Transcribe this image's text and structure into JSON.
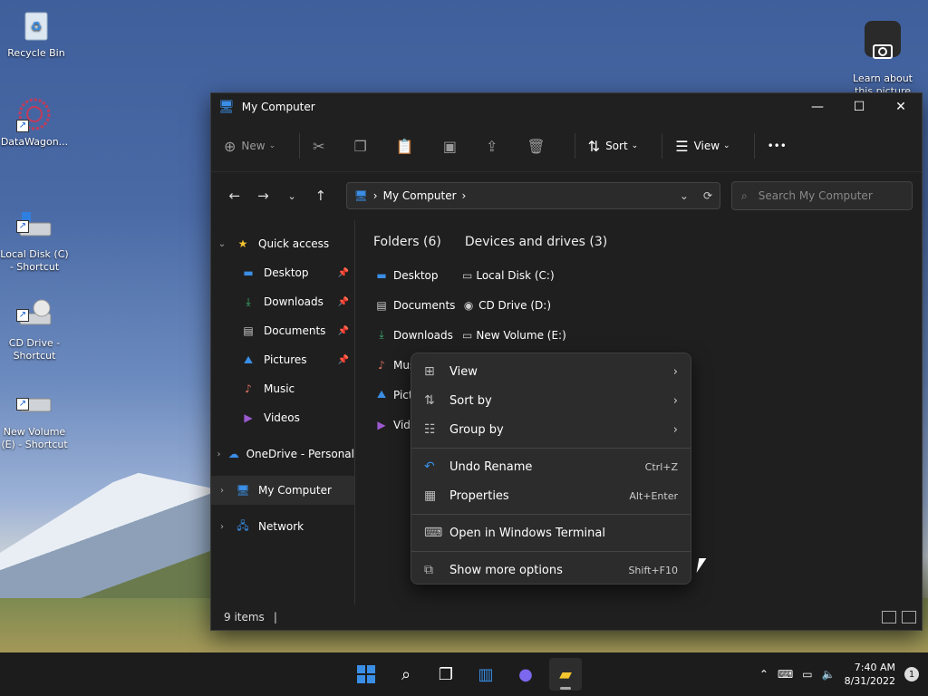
{
  "desktop": {
    "icons": [
      {
        "label": "Recycle Bin"
      },
      {
        "label": "DataWagon..."
      },
      {
        "label": "Local Disk (C)\n- Shortcut"
      },
      {
        "label": "CD Drive -\nShortcut"
      },
      {
        "label": "New Volume\n(E) - Shortcut"
      }
    ],
    "learn": "Learn about\nthis picture"
  },
  "window": {
    "title": "My Computer",
    "controls": {
      "minimize": "—",
      "maximize": "☐",
      "close": "✕"
    }
  },
  "cmdbar": {
    "new": "New",
    "sort": "Sort",
    "view": "View",
    "more": "•••"
  },
  "address": {
    "crumb": "My Computer",
    "search_placeholder": "Search My Computer"
  },
  "nav": {
    "quick_access": "Quick access",
    "items": [
      {
        "label": "Desktop"
      },
      {
        "label": "Downloads"
      },
      {
        "label": "Documents"
      },
      {
        "label": "Pictures"
      },
      {
        "label": "Music"
      },
      {
        "label": "Videos"
      }
    ],
    "onedrive": "OneDrive - Personal",
    "my_computer": "My Computer",
    "network": "Network"
  },
  "content": {
    "folders_header": "Folders (6)",
    "devices_header": "Devices and drives (3)",
    "folders": [
      {
        "label": "Desktop"
      },
      {
        "label": "Documents"
      },
      {
        "label": "Downloads"
      },
      {
        "label": "Music"
      },
      {
        "label": "Pictures"
      },
      {
        "label": "Videos"
      }
    ],
    "drives": [
      {
        "label": "Local Disk (C:)"
      },
      {
        "label": "CD Drive (D:)"
      },
      {
        "label": "New Volume (E:)"
      }
    ]
  },
  "context_menu": {
    "view": "View",
    "sort_by": "Sort by",
    "group_by": "Group by",
    "undo_rename": "Undo Rename",
    "undo_shortcut": "Ctrl+Z",
    "properties": "Properties",
    "properties_shortcut": "Alt+Enter",
    "terminal": "Open in Windows Terminal",
    "more_options": "Show more options",
    "more_options_shortcut": "Shift+F10"
  },
  "status": {
    "items": "9 items"
  },
  "taskbar": {
    "time": "7:40 AM",
    "date": "8/31/2022",
    "notifications": "1"
  },
  "colors": {
    "accent": "#3a8ee6"
  }
}
